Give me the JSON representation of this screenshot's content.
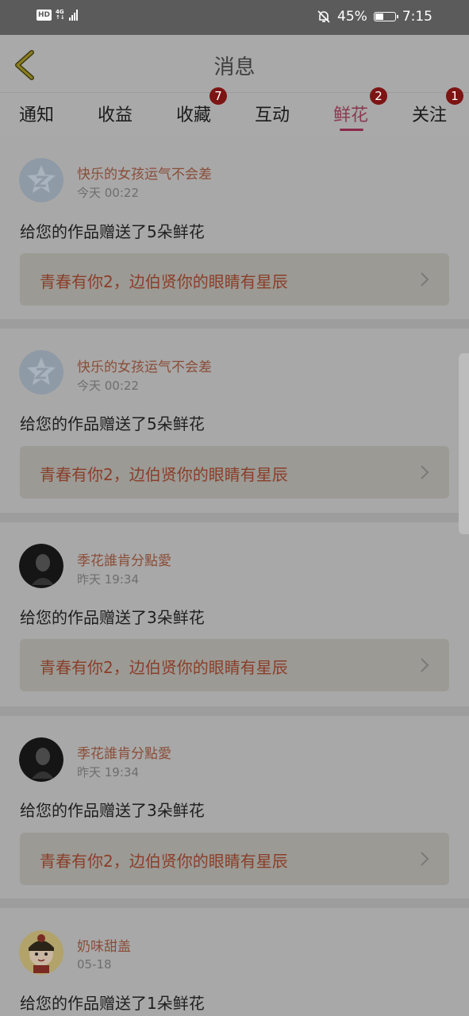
{
  "status_bar": {
    "hd": "HD",
    "network": "4G",
    "battery": "45%",
    "time": "7:15",
    "battery_level": 0.45
  },
  "header": {
    "title": "消息"
  },
  "tabs": [
    {
      "label": "通知",
      "badge": ""
    },
    {
      "label": "收益",
      "badge": ""
    },
    {
      "label": "收藏",
      "badge": "7"
    },
    {
      "label": "互动",
      "badge": ""
    },
    {
      "label": "鲜花",
      "badge": "2"
    },
    {
      "label": "关注",
      "badge": "1"
    }
  ],
  "active_tab": "鲜花",
  "messages": [
    {
      "user": "快乐的女孩运气不会差",
      "time": "今天 00:22",
      "text": "给您的作品赠送了5朵鲜花",
      "work": "青春有你2，边伯贤你的眼睛有星辰",
      "avatar": "default-avatar-icon"
    },
    {
      "user": "快乐的女孩运气不会差",
      "time": "今天 00:22",
      "text": "给您的作品赠送了5朵鲜花",
      "work": "青春有你2，边伯贤你的眼睛有星辰",
      "avatar": "default-avatar-icon"
    },
    {
      "user": "季花誰肯分點愛",
      "time": "昨天 19:34",
      "text": "给您的作品赠送了3朵鲜花",
      "work": "青春有你2，边伯贤你的眼睛有星辰",
      "avatar": "photo-avatar"
    },
    {
      "user": "季花誰肯分點愛",
      "time": "昨天 19:34",
      "text": "给您的作品赠送了3朵鲜花",
      "work": "青春有你2，边伯贤你的眼睛有星辰",
      "avatar": "photo-avatar"
    },
    {
      "user": "奶味甜盖",
      "time": "05-18",
      "text": "给您的作品赠送了1朵鲜花",
      "work": "",
      "avatar": "cartoon-avatar"
    }
  ],
  "colors": {
    "overlay_bg": "#a9a9a9",
    "accent": "#8a2a4a",
    "badge": "#7d1414",
    "username": "#8a4d38",
    "work_title": "#8b3e28"
  }
}
